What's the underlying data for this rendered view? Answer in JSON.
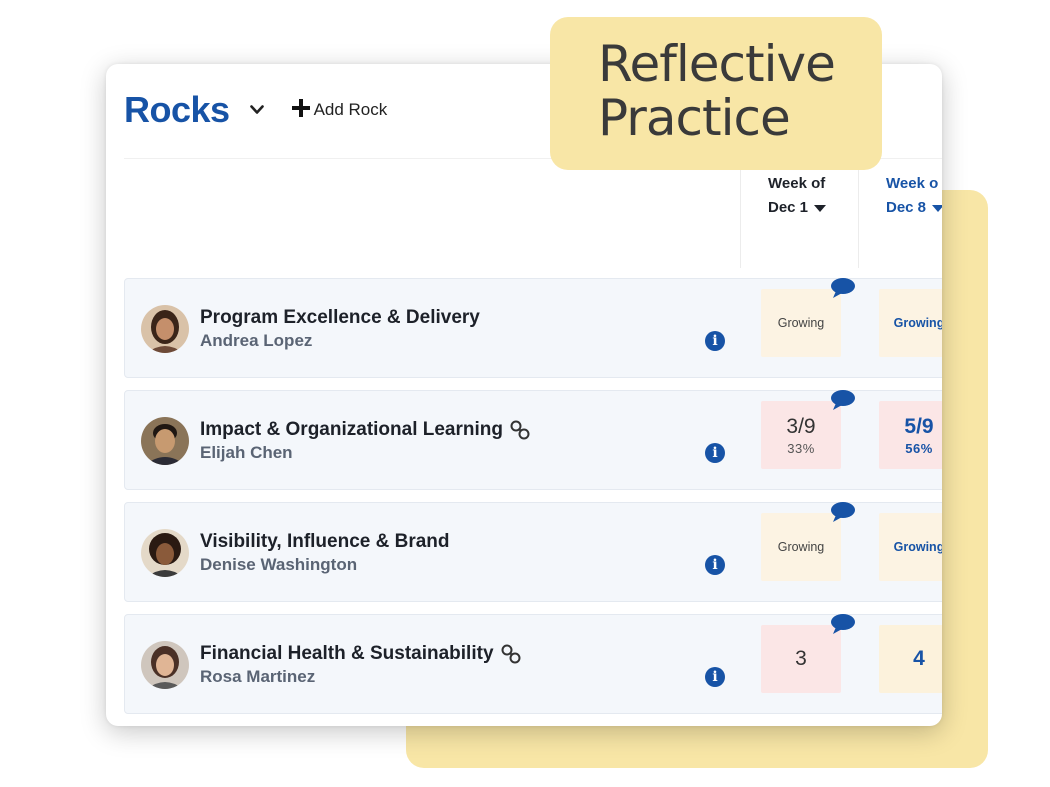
{
  "header": {
    "title": "Rocks",
    "add_label": "Add Rock"
  },
  "weeks": [
    {
      "line1": "Week of",
      "line2": "Dec 1"
    },
    {
      "line1": "Week o",
      "line2": "Dec 8"
    }
  ],
  "rows": [
    {
      "title": "Program Excellence & Delivery",
      "owner": "Andrea Lopez",
      "linked": false,
      "cells": [
        {
          "word": "Growing"
        },
        {
          "word": "Growing"
        }
      ]
    },
    {
      "title": "Impact & Organizational Learning",
      "owner": "Elijah Chen",
      "linked": true,
      "cells": [
        {
          "main": "3/9",
          "sub": "33%"
        },
        {
          "main": "5/9",
          "sub": "56%"
        }
      ]
    },
    {
      "title": "Visibility, Influence & Brand",
      "owner": "Denise Washington",
      "linked": false,
      "cells": [
        {
          "word": "Growing"
        },
        {
          "word": "Growing"
        }
      ]
    },
    {
      "title": "Financial Health & Sustainability",
      "owner": "Rosa Martinez",
      "linked": true,
      "cells": [
        {
          "main": "3"
        },
        {
          "main": "4"
        }
      ]
    }
  ],
  "banner": {
    "line1": "Reflective",
    "line2": "Practice"
  },
  "colors": {
    "accent": "#1753a6",
    "banner": "#f8e6a6",
    "row_bg": "#f4f7fb"
  },
  "icons": [
    "chevron-down-icon",
    "plus-icon",
    "link-icon",
    "info-icon",
    "comment-icon",
    "caret-down-icon"
  ]
}
